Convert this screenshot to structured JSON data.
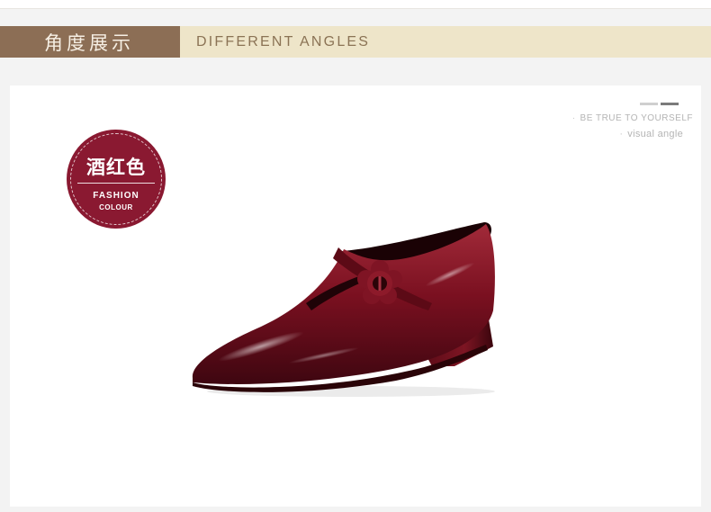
{
  "header": {
    "title_cn": "角度展示",
    "title_en": "DIFFERENT ANGLES"
  },
  "badge": {
    "color_name": "酒红色",
    "line1": "FASHION",
    "line2": "COLOUR"
  },
  "taglines": {
    "line1": "BE TRUE TO YOURSELF",
    "line2": "visual angle"
  },
  "colors": {
    "header_left_bg": "#8c6e55",
    "header_right_bg": "#eee5c9",
    "badge_bg": "#8a1931",
    "shoe_color": "#7a0f1f"
  },
  "icons": {
    "badge": "color-badge",
    "slider": "slider-indicator",
    "product": "shoe-image"
  }
}
